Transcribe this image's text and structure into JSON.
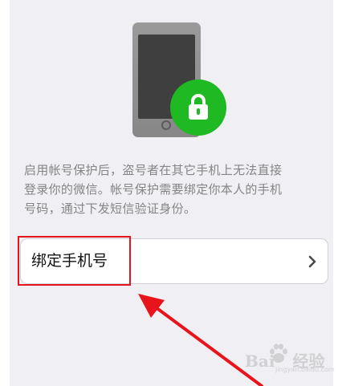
{
  "security": {
    "description_lines": [
      "启用帐号保护后，盗号者在其它手机上无法直接",
      "登录你的微信。帐号保护需要绑定你本人的手机",
      "号码，通过下发短信验证身份。"
    ],
    "bind_phone_label": "绑定手机号"
  },
  "colors": {
    "background": "#efeff4",
    "lock_badge": "#1fb923",
    "annotation": "#e8141c",
    "description_text": "#858585"
  },
  "icons": {
    "hero": "phone-icon",
    "badge": "lock-icon",
    "row_action": "chevron-right-icon"
  },
  "watermark": {
    "brand": "Baidu",
    "product": "经验",
    "url": "jingyan.baidu.com"
  }
}
